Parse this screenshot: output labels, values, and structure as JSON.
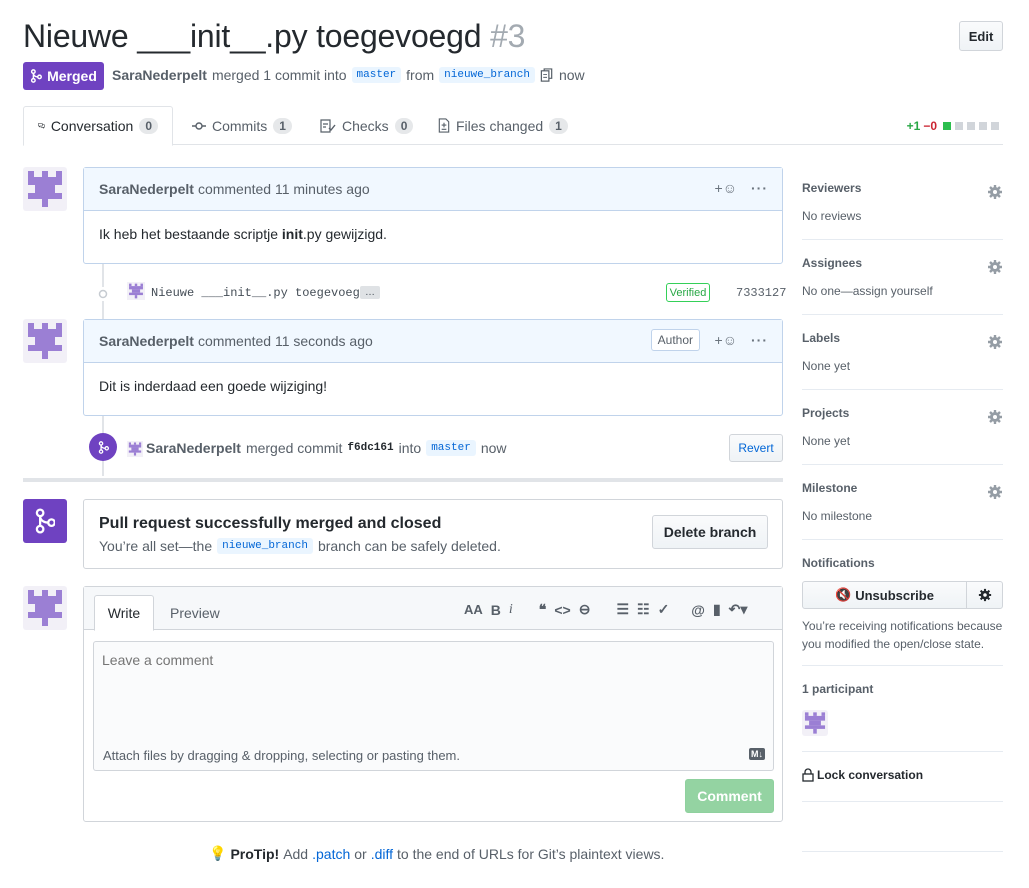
{
  "pr": {
    "title": "Nieuwe ___init__.py toegevoegd",
    "number": "#3",
    "edit_label": "Edit",
    "state": "Merged",
    "author": "SaraNederpelt",
    "merged_text": "merged 1 commit into",
    "base_branch": "master",
    "from_text": "from",
    "head_branch": "nieuwe_branch",
    "time": "now"
  },
  "tabs": [
    {
      "label": "Conversation",
      "count": "0"
    },
    {
      "label": "Commits",
      "count": "1"
    },
    {
      "label": "Checks",
      "count": "0"
    },
    {
      "label": "Files changed",
      "count": "1"
    }
  ],
  "diffstat": {
    "added": "+1",
    "removed": "−0"
  },
  "comment1": {
    "author": "SaraNederpelt",
    "meta": "commented 11 minutes ago",
    "body_pre": "Ik heb het bestaande scriptje ",
    "body_bold": "init",
    "body_post": ".py gewijzigd."
  },
  "commit": {
    "message": "Nieuwe ___init__.py toegevoegd",
    "ellipsis": "…",
    "verified": "Verified",
    "sha": "7333127"
  },
  "comment2": {
    "author": "SaraNederpelt",
    "meta": "commented 11 seconds ago",
    "badge": "Author",
    "body": "Dit is inderdaad een goede wijziging!"
  },
  "merge_event": {
    "author": "SaraNederpelt",
    "text1": "merged commit",
    "sha": "f6dc161",
    "text2": "into",
    "branch": "master",
    "time": "now",
    "revert_label": "Revert"
  },
  "merged_box": {
    "title": "Pull request successfully merged and closed",
    "sub_pre": "You’re all set—the",
    "branch": "nieuwe_branch",
    "sub_post": "branch can be safely deleted.",
    "delete_label": "Delete branch"
  },
  "editor": {
    "tab_write": "Write",
    "tab_preview": "Preview",
    "placeholder": "Leave a comment",
    "attach_text": "Attach files by dragging & dropping, selecting or pasting them.",
    "comment_label": "Comment",
    "md_badge": "M↓"
  },
  "protip": {
    "bold": "ProTip!",
    "pre": "Add",
    "patch": ".patch",
    "or": "or",
    "diff": ".diff",
    "post": "to the end of URLs for Git’s plaintext views."
  },
  "sidebar": {
    "reviewers": {
      "label": "Reviewers",
      "value": "No reviews"
    },
    "assignees": {
      "label": "Assignees",
      "value": "No one—assign yourself"
    },
    "labels": {
      "label": "Labels",
      "value": "None yet"
    },
    "projects": {
      "label": "Projects",
      "value": "None yet"
    },
    "milestone": {
      "label": "Milestone",
      "value": "No milestone"
    },
    "notifications": {
      "label": "Notifications",
      "unsubscribe": "Unsubscribe",
      "reason": "You’re receiving notifications because you modified the open/close state."
    },
    "participants": {
      "label": "1 participant"
    },
    "lock": {
      "label": "Lock conversation"
    }
  },
  "colors": {
    "purple": "#6f42c1",
    "green": "#28a745",
    "link": "#0366d6",
    "avatar": "#9b7fd4"
  }
}
